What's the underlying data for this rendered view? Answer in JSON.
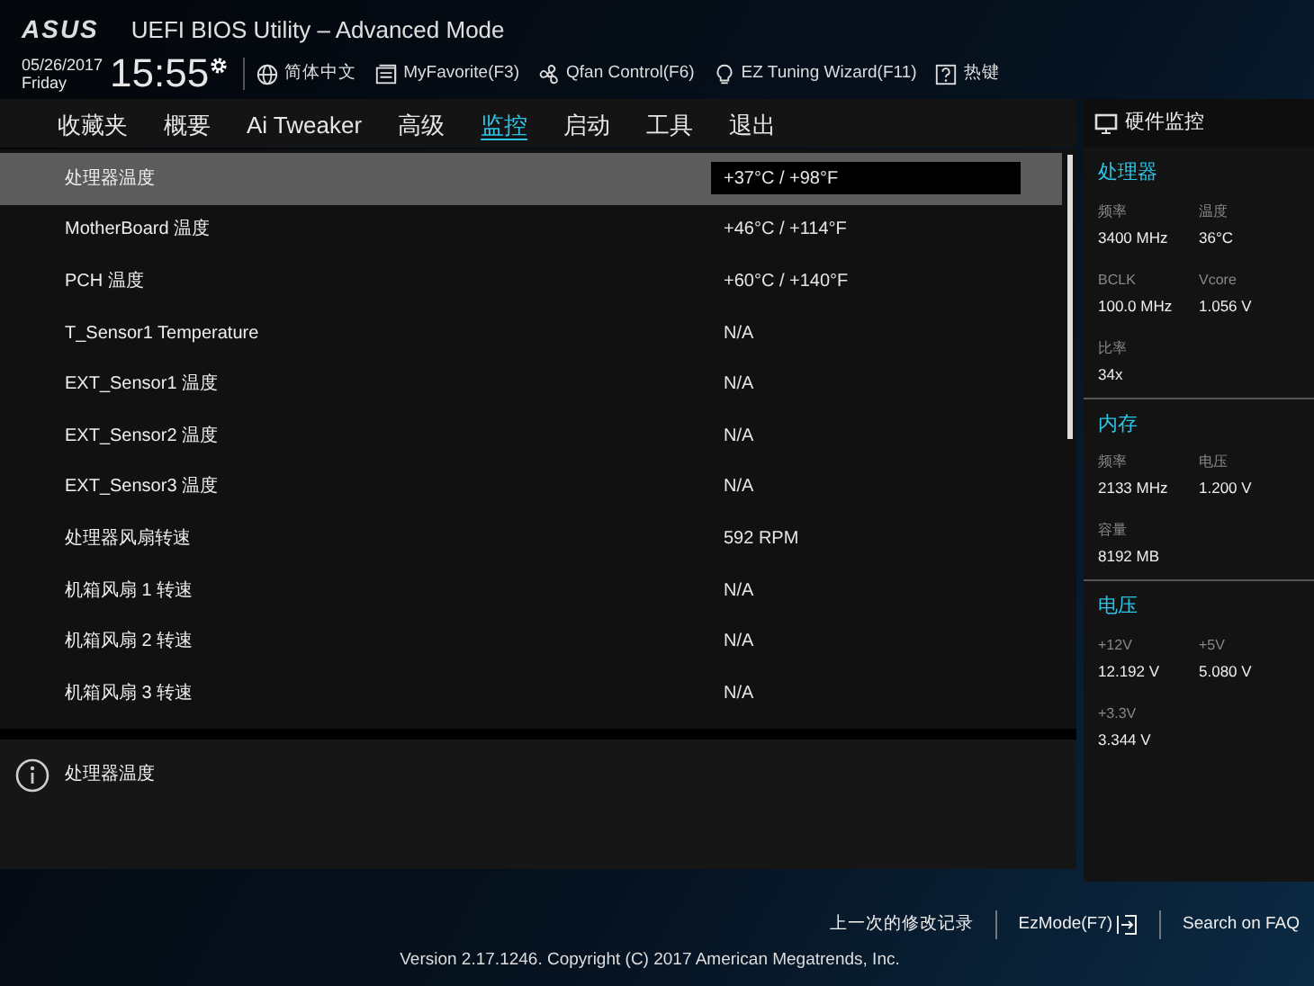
{
  "header": {
    "logo": "ASUS",
    "title": "UEFI BIOS Utility – Advanced Mode",
    "date": "05/26/2017",
    "day": "Friday",
    "time": "15:55",
    "tools": [
      {
        "kind": "globe",
        "label": "简体中文"
      },
      {
        "kind": "favorite",
        "label": "MyFavorite(F3)"
      },
      {
        "kind": "fan",
        "label": "Qfan Control(F6)"
      },
      {
        "kind": "bulb",
        "label": "EZ Tuning Wizard(F11)"
      },
      {
        "kind": "help",
        "label": "热键"
      }
    ]
  },
  "tabs": [
    {
      "label": "收藏夹",
      "selected": false
    },
    {
      "label": "概要",
      "selected": false
    },
    {
      "label": "Ai Tweaker",
      "selected": false
    },
    {
      "label": "高级",
      "selected": false
    },
    {
      "label": "监控",
      "selected": true
    },
    {
      "label": "启动",
      "selected": false
    },
    {
      "label": "工具",
      "selected": false
    },
    {
      "label": "退出",
      "selected": false
    }
  ],
  "items": [
    {
      "label": "处理器温度",
      "value": "+37°C / +98°F",
      "selected": true
    },
    {
      "label": "MotherBoard 温度",
      "value": "+46°C / +114°F",
      "selected": false
    },
    {
      "label": "PCH 温度",
      "value": "+60°C / +140°F",
      "selected": false
    },
    {
      "label": "T_Sensor1 Temperature",
      "value": "N/A",
      "selected": false
    },
    {
      "label": "EXT_Sensor1 温度",
      "value": "N/A",
      "selected": false
    },
    {
      "label": "EXT_Sensor2 温度",
      "value": "N/A",
      "selected": false
    },
    {
      "label": "EXT_Sensor3 温度",
      "value": "N/A",
      "selected": false
    },
    {
      "label": "处理器风扇转速",
      "value": "592 RPM",
      "selected": false
    },
    {
      "label": "机箱风扇 1 转速",
      "value": "N/A",
      "selected": false
    },
    {
      "label": "机箱风扇 2 转速",
      "value": "N/A",
      "selected": false
    },
    {
      "label": "机箱风扇 3 转速",
      "value": "N/A",
      "selected": false
    }
  ],
  "help_text": "处理器温度",
  "hardware_monitor": {
    "title": "硬件监控",
    "sections": [
      {
        "title": "处理器",
        "fields": [
          {
            "label": "频率",
            "value": "3400 MHz"
          },
          {
            "label": "温度",
            "value": "36°C"
          },
          {
            "label": "BCLK",
            "value": "100.0 MHz"
          },
          {
            "label": "Vcore",
            "value": "1.056 V"
          },
          {
            "label": "比率",
            "value": "34x"
          }
        ]
      },
      {
        "title": "内存",
        "fields": [
          {
            "label": "频率",
            "value": "2133 MHz"
          },
          {
            "label": "电压",
            "value": "1.200 V"
          },
          {
            "label": "容量",
            "value": "8192 MB"
          }
        ]
      },
      {
        "title": "电压",
        "fields": [
          {
            "label": "+12V",
            "value": "12.192 V"
          },
          {
            "label": "+5V",
            "value": "5.080 V"
          },
          {
            "label": "+3.3V",
            "value": "3.344 V"
          }
        ]
      }
    ]
  },
  "footer": {
    "links": [
      "上一次的修改记录",
      "EzMode(F7)",
      "Search on FAQ"
    ],
    "version": "Version 2.17.1246. Copyright (C) 2017 American Megatrends, Inc."
  }
}
